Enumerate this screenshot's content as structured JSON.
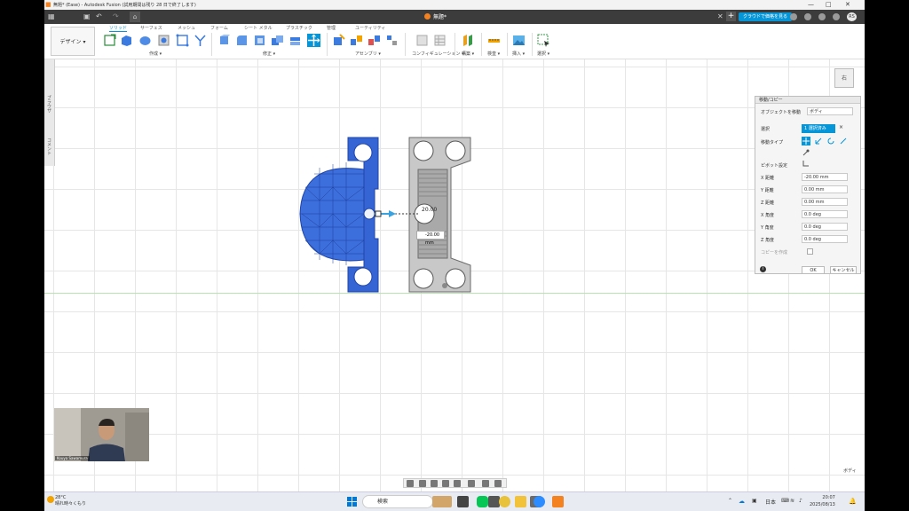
{
  "titlebar": {
    "title": "無題* (Ease) - Autodesk Fusion (試用期間は残り 28 日で終了します)"
  },
  "tabbar": {
    "doc_tab": "無題*",
    "cloud_button": "クラウドで価格を見る",
    "user_initials": "RS"
  },
  "ribbon": {
    "workspace": "デザイン ▾",
    "tabs": [
      "ソリッド",
      "サーフェス",
      "メッシュ",
      "フォーム",
      "シート メタル",
      "プラスチック",
      "管理",
      "ユーティリティ"
    ],
    "groups": [
      "作成 ▾",
      "修正 ▾",
      "アセンブリ ▾",
      "コンフィギュレーション ▾",
      "構築 ▾",
      "検査 ▾",
      "挿入 ▾",
      "選択 ▾"
    ]
  },
  "browser": {
    "vertical_labels": [
      "ブラウザ",
      "コメント"
    ]
  },
  "viewcube": {
    "face": "右"
  },
  "move_panel": {
    "title": "移動/コピー",
    "object_label": "オブジェクトを移動",
    "object_value": "ボディ",
    "select_label": "選択",
    "select_value": "1 選択済み",
    "move_type_label": "移動タイプ",
    "pivot_label": "ピボット設定",
    "x_dist_label": "X 距離",
    "x_dist": "-20.00 mm",
    "y_dist_label": "Y 距離",
    "y_dist": "0.00 mm",
    "z_dist_label": "Z 距離",
    "z_dist": "0.00 mm",
    "x_angle_label": "X 角度",
    "x_angle": "0.0 deg",
    "y_angle_label": "Y 角度",
    "y_angle": "0.0 deg",
    "z_angle_label": "Z 角度",
    "z_angle": "0.0 deg",
    "copy_label": "コピーを作成",
    "ok": "OK",
    "cancel": "キャンセル"
  },
  "viewport": {
    "dim_top": "20.00",
    "dim_input": "-20.00 mm"
  },
  "webcam": {
    "name": "Kouya Sawamura"
  },
  "status": {
    "selection": "ボディ"
  },
  "taskbar": {
    "temp": "28°C",
    "weather": "晴れ時々くもり",
    "search": "検索",
    "ime": "日本",
    "time": "20:07",
    "date": "2025/08/13"
  },
  "colors": {
    "accent": "#0696d7",
    "body_blue": "#3565d4",
    "body_gray": "#c8c8c8",
    "brand_orange": "#f58220"
  }
}
